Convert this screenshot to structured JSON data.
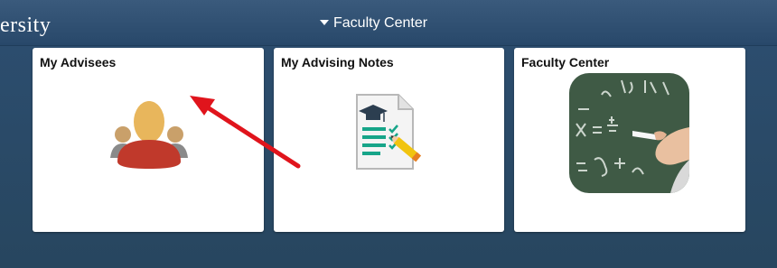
{
  "header": {
    "brand_partial": "ersity",
    "homepage_selector": "Faculty Center"
  },
  "tiles": [
    {
      "title": "My Advisees",
      "icon": "advisees-people-icon"
    },
    {
      "title": "My Advising Notes",
      "icon": "advising-notes-document-icon"
    },
    {
      "title": "Faculty Center",
      "icon": "chalkboard-math-icon"
    }
  ],
  "colors": {
    "banner": "#2f5274",
    "page_background": "#2a4c6c",
    "tile_background": "#ffffff",
    "annotation_arrow": "#e0141c"
  },
  "annotation": {
    "type": "arrow",
    "points_to": "My Advisees tile icon"
  }
}
